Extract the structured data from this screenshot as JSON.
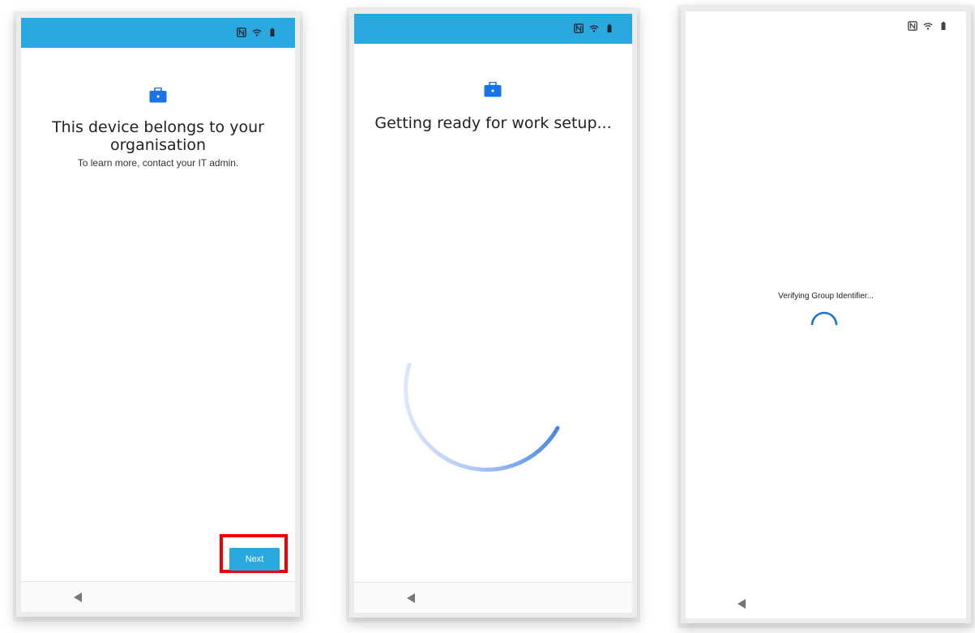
{
  "colors": {
    "status_bar": "#2aa8e0",
    "briefcase": "#1a73e8",
    "next_button": "#2aa8e0",
    "highlight_border": "#ec0000",
    "spinner_large": "#4285f4",
    "spinner_small": "#1976d2"
  },
  "status_icons": [
    "nfc-icon",
    "wifi-icon",
    "battery-icon"
  ],
  "screens": [
    {
      "title_line1": "This device belongs to your",
      "title_line2": "organisation",
      "subtitle": "To learn more, contact your IT admin.",
      "next_label": "Next"
    },
    {
      "title": "Getting ready for work setup..."
    },
    {
      "message": "Verifying Group Identifier..."
    }
  ]
}
